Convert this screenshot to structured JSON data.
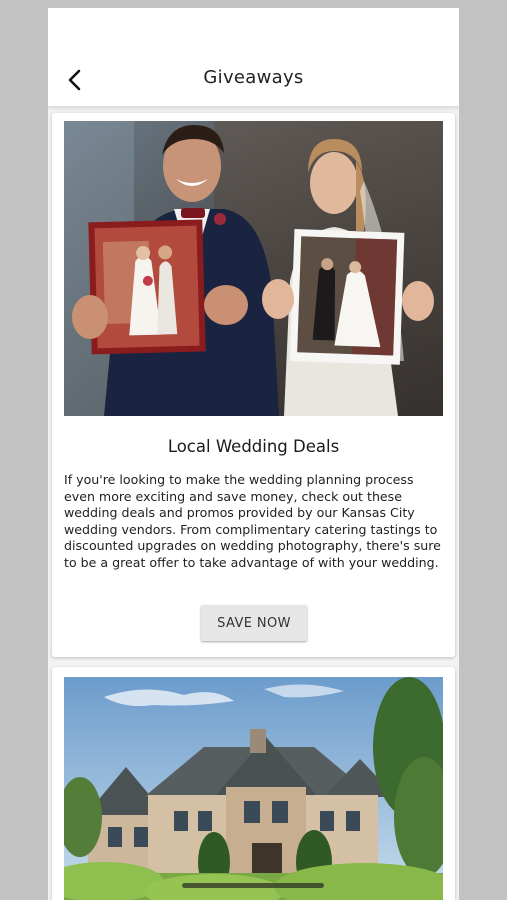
{
  "header": {
    "title": "Giveaways",
    "back_icon": "chevron-left-icon"
  },
  "cards": [
    {
      "image": "couple holding wedding photos",
      "title": "Local Wedding Deals",
      "body": "If you're looking to make the wedding planning process even more exciting and save money, check out these wedding deals and promos provided by our Kansas City wedding vendors. From complimentary catering tastings to discounted upgrades on wedding photography, there's sure to be a great offer to take advantage of with your wedding.",
      "button_label": "SAVE NOW"
    },
    {
      "image": "estate house with trees"
    }
  ],
  "colors": {
    "background": "#c2c2c2",
    "surface": "#ffffff",
    "feed_background": "#f2f2f2",
    "button": "#e6e6e6",
    "text": "#222222"
  }
}
